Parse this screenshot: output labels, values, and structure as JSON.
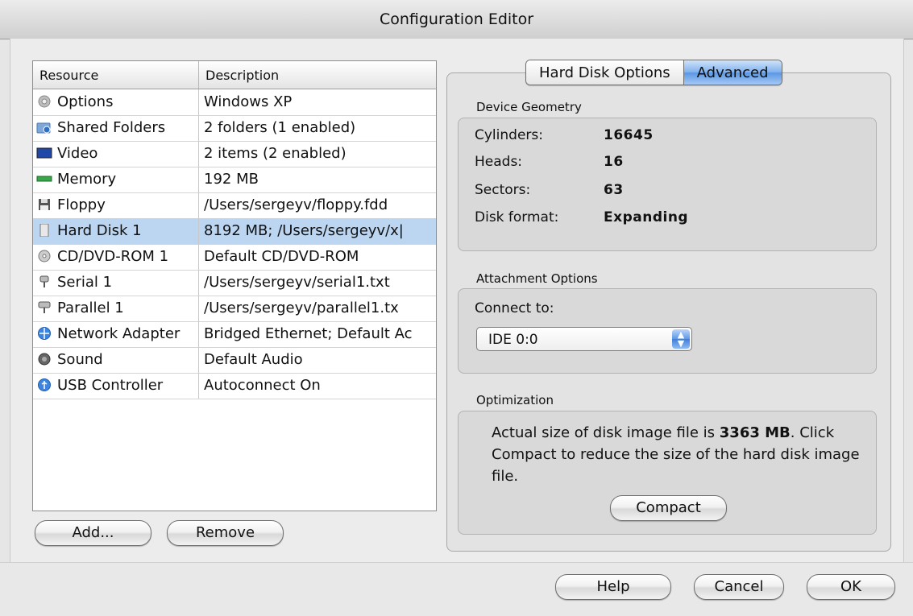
{
  "window": {
    "title": "Configuration Editor"
  },
  "table": {
    "headers": {
      "resource": "Resource",
      "description": "Description"
    },
    "rows": [
      {
        "resource": "Options",
        "description": "Windows XP",
        "icon": "gear-icon"
      },
      {
        "resource": "Shared Folders",
        "description": "2 folders (1 enabled)",
        "icon": "shared-folder-icon"
      },
      {
        "resource": "Video",
        "description": "2 items (2 enabled)",
        "icon": "monitor-icon"
      },
      {
        "resource": "Memory",
        "description": "192 MB",
        "icon": "memory-chip-icon"
      },
      {
        "resource": "Floppy",
        "description": "/Users/sergeyv/floppy.fdd",
        "icon": "floppy-icon"
      },
      {
        "resource": "Hard Disk 1",
        "description": "8192 MB; /Users/sergeyv/x|",
        "icon": "hard-disk-icon",
        "selected": true
      },
      {
        "resource": "CD/DVD-ROM 1",
        "description": "Default CD/DVD-ROM",
        "icon": "cd-dvd-icon"
      },
      {
        "resource": "Serial 1",
        "description": "/Users/sergeyv/serial1.txt",
        "icon": "serial-port-icon"
      },
      {
        "resource": "Parallel 1",
        "description": "/Users/sergeyv/parallel1.tx",
        "icon": "parallel-port-icon"
      },
      {
        "resource": "Network Adapter",
        "description": "Bridged Ethernet; Default Ac",
        "icon": "network-icon"
      },
      {
        "resource": "Sound",
        "description": "Default Audio",
        "icon": "speaker-icon"
      },
      {
        "resource": "USB Controller",
        "description": "Autoconnect On",
        "icon": "usb-icon"
      }
    ]
  },
  "table_buttons": {
    "add": "Add...",
    "remove": "Remove"
  },
  "tabs": [
    {
      "label": "Hard Disk Options",
      "active": false
    },
    {
      "label": "Advanced",
      "active": true
    }
  ],
  "device_geometry": {
    "label": "Device Geometry",
    "cylinders_label": "Cylinders:",
    "cylinders": "16645",
    "heads_label": "Heads:",
    "heads": "16",
    "sectors_label": "Sectors:",
    "sectors": "63",
    "format_label": "Disk format:",
    "format": "Expanding"
  },
  "attachment": {
    "label": "Attachment Options",
    "connect_label": "Connect to:",
    "connect_value": "IDE 0:0"
  },
  "optimization": {
    "label": "Optimization",
    "text_before": "Actual size of disk image file is ",
    "size": "3363 MB",
    "text_after": ". Click Compact to reduce the size of the hard disk image file.",
    "compact_button": "Compact"
  },
  "dialog_buttons": {
    "help": "Help",
    "cancel": "Cancel",
    "ok": "OK"
  },
  "colors": {
    "selection": "#bcd6f2",
    "accent": "#5b96e3"
  }
}
